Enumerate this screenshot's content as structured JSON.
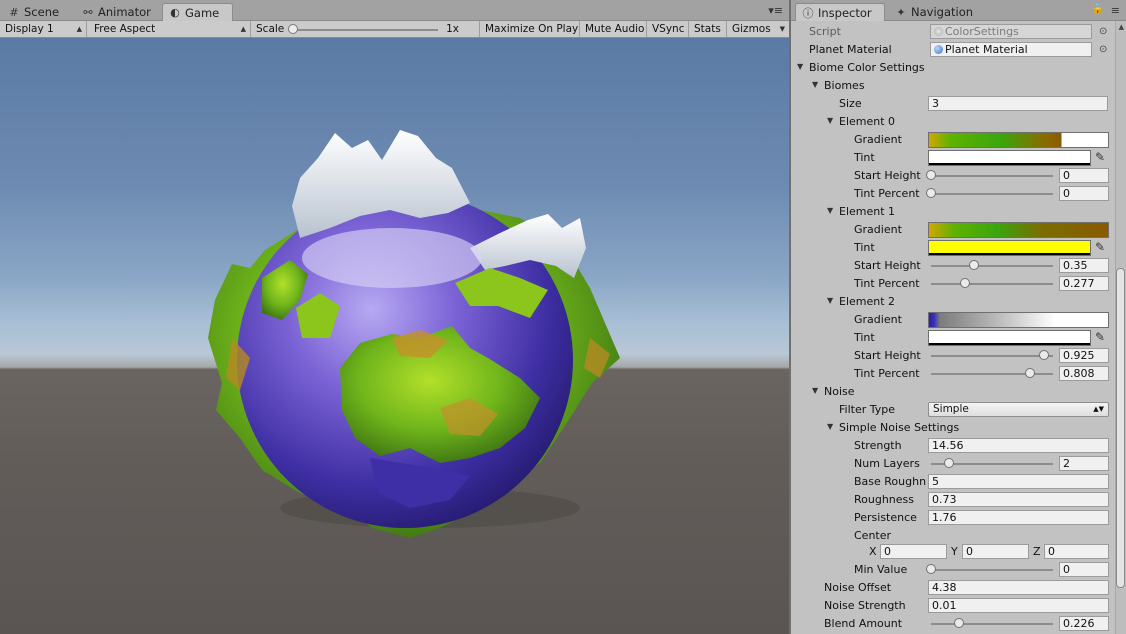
{
  "left_tabs": [
    {
      "label": "Scene",
      "icon": "scene-grid-icon"
    },
    {
      "label": "Animator",
      "icon": "animator-icon"
    },
    {
      "label": "Game",
      "icon": "game-controller-icon"
    }
  ],
  "left_toolbar": {
    "display": "Display 1",
    "aspect": "Free Aspect",
    "scale_label": "Scale",
    "scale_value": "1x",
    "maximize": "Maximize On Play",
    "mute": "Mute Audio",
    "vsync": "VSync",
    "stats": "Stats",
    "gizmos": "Gizmos"
  },
  "right_tabs": [
    {
      "label": "Inspector",
      "icon": "info-icon"
    },
    {
      "label": "Navigation",
      "icon": "navigation-icon"
    }
  ],
  "inspector": {
    "script_label": "Script",
    "script_value": "ColorSettings",
    "planet_material_label": "Planet Material",
    "planet_material_value": "Planet Material",
    "biome_color_settings": "Biome Color Settings",
    "biomes": "Biomes",
    "size_label": "Size",
    "size_value": "3",
    "gradient_label": "Gradient",
    "tint_label": "Tint",
    "start_height_label": "Start Height",
    "tint_percent_label": "Tint Percent",
    "elements": [
      {
        "title": "Element 0",
        "tint_color": "#ffffff",
        "start_height": "0",
        "start_height_frac": 0.0,
        "tint_percent": "0",
        "tint_percent_frac": 0.0
      },
      {
        "title": "Element 1",
        "tint_color": "#ffff00",
        "start_height": "0.35",
        "start_height_frac": 0.35,
        "tint_percent": "0.277",
        "tint_percent_frac": 0.277
      },
      {
        "title": "Element 2",
        "tint_color": "#ffffff",
        "start_height": "0.925",
        "start_height_frac": 0.925,
        "tint_percent": "0.808",
        "tint_percent_frac": 0.808
      }
    ],
    "noise": "Noise",
    "filter_type_label": "Filter Type",
    "filter_type_value": "Simple",
    "simple_noise_settings": "Simple Noise Settings",
    "strength_label": "Strength",
    "strength_value": "14.56",
    "num_layers_label": "Num Layers",
    "num_layers_value": "2",
    "num_layers_frac": 0.15,
    "base_roughness_label": "Base Roughn",
    "base_roughness_value": "5",
    "roughness_label": "Roughness",
    "roughness_value": "0.73",
    "persistence_label": "Persistence",
    "persistence_value": "1.76",
    "center_label": "Center",
    "x_label": "X",
    "x_value": "0",
    "y_label": "Y",
    "y_value": "0",
    "z_label": "Z",
    "z_value": "0",
    "min_value_label": "Min Value",
    "min_value_value": "0",
    "min_value_frac": 0.0,
    "noise_offset_label": "Noise Offset",
    "noise_offset_value": "4.38",
    "noise_strength_label": "Noise Strength",
    "noise_strength_value": "0.01",
    "blend_amount_label": "Blend Amount",
    "blend_amount_value": "0.226",
    "blend_amount_frac": 0.226
  }
}
